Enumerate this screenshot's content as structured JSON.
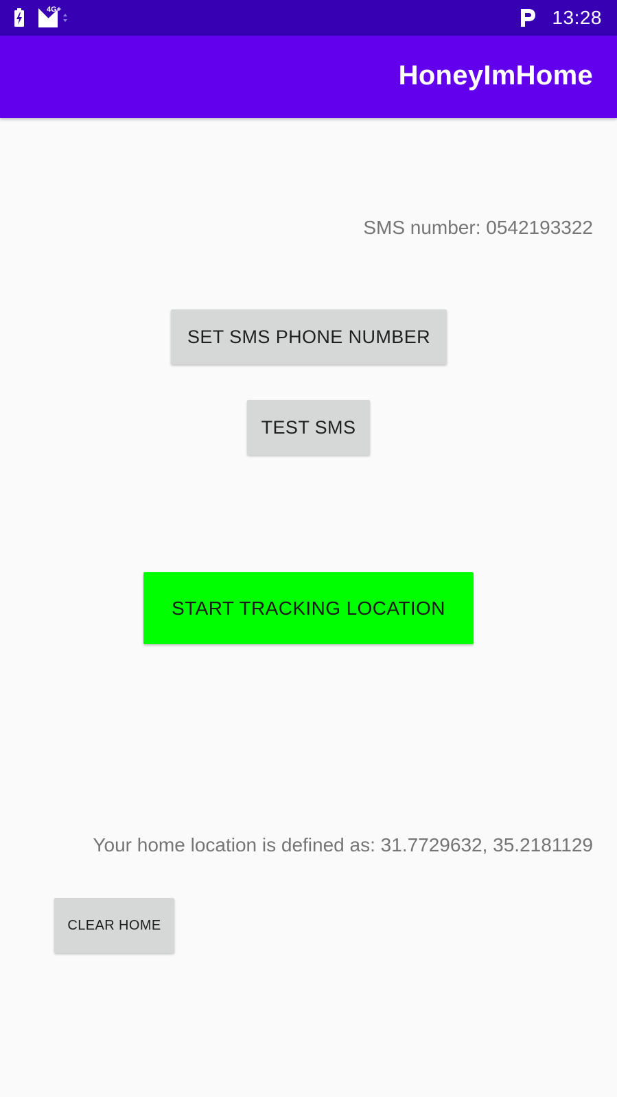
{
  "status_bar": {
    "network_type": "4G+",
    "time": "13:28",
    "icons": [
      "battery-charging-icon",
      "signal-icon",
      "parking-icon"
    ]
  },
  "app_bar": {
    "title": "HoneyImHome",
    "color": "#6200ee",
    "status_color": "#3700b3"
  },
  "main": {
    "sms_number_text": "SMS number: 0542193322",
    "set_sms_button": "SET SMS PHONE NUMBER",
    "test_sms_button": "TEST SMS",
    "tracking_button": "START TRACKING LOCATION",
    "tracking_button_color": "#00ff00",
    "home_location_text": "Your home location is defined as: 31.7729632, 35.2181129",
    "clear_home_button": "CLEAR HOME"
  }
}
